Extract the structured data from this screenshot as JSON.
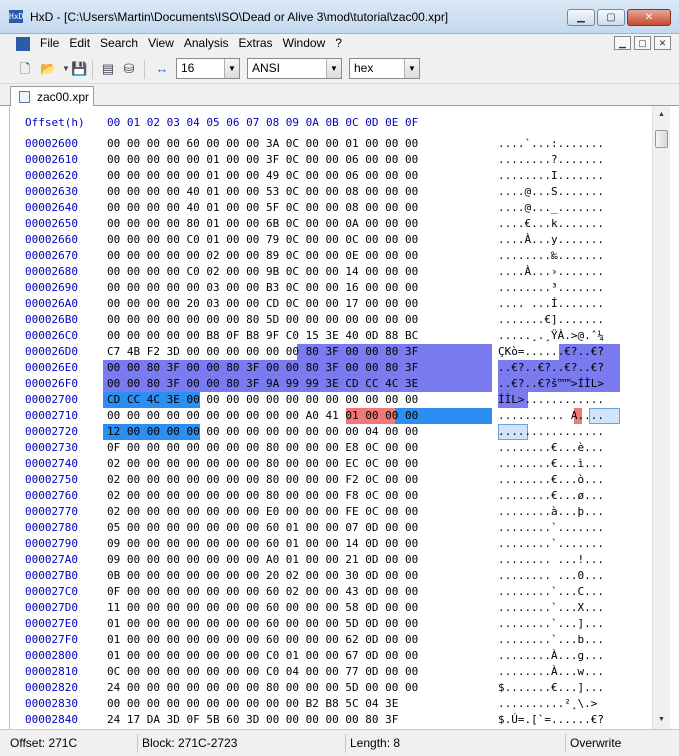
{
  "window": {
    "app_icon": "HxD",
    "title": "HxD - [C:\\Users\\Martin\\Documents\\ISO\\Dead or Alive 3\\mod\\tutorial\\zac00.xpr]",
    "minimize": "▁",
    "maximize": "▢",
    "close": "✕"
  },
  "menu": {
    "items": [
      "File",
      "Edit",
      "Search",
      "View",
      "Analysis",
      "Extras",
      "Window",
      "?"
    ],
    "mdi": [
      "▁",
      "▢",
      "✕"
    ]
  },
  "toolbar": {
    "bytes_per_row": "16",
    "charset": "ANSI",
    "offset_base": "hex",
    "icons": [
      "new-file-icon",
      "open-file-icon",
      "dropdown-arrow-icon",
      "save-icon",
      "ram-icon",
      "disk-icon",
      "columns-icon"
    ]
  },
  "tab": {
    "label": "zac00.xpr"
  },
  "editor": {
    "header_offset": "Offset(h)",
    "header_bytes": "00 01 02 03 04 05 06 07 08 09 0A 0B 0C 0D 0E 0F",
    "rows": [
      {
        "off": "00002600",
        "hex": "00 00 00 00 60 00 00 00 3A 0C 00 00 01 00 00 00",
        "txt": "....`...:......."
      },
      {
        "off": "00002610",
        "hex": "00 00 00 00 00 01 00 00 3F 0C 00 00 06 00 00 00",
        "txt": "........?......."
      },
      {
        "off": "00002620",
        "hex": "00 00 00 00 00 01 00 00 49 0C 00 00 06 00 00 00",
        "txt": "........I......."
      },
      {
        "off": "00002630",
        "hex": "00 00 00 00 40 01 00 00 53 0C 00 00 08 00 00 00",
        "txt": "....@...S......."
      },
      {
        "off": "00002640",
        "hex": "00 00 00 00 40 01 00 00 5F 0C 00 00 08 00 00 00",
        "txt": "....@..._......."
      },
      {
        "off": "00002650",
        "hex": "00 00 00 00 80 01 00 00 6B 0C 00 00 0A 00 00 00",
        "txt": "....€...k......."
      },
      {
        "off": "00002660",
        "hex": "00 00 00 00 C0 01 00 00 79 0C 00 00 0C 00 00 00",
        "txt": "....À...y......."
      },
      {
        "off": "00002670",
        "hex": "00 00 00 00 00 02 00 00 89 0C 00 00 0E 00 00 00",
        "txt": "........‰......."
      },
      {
        "off": "00002680",
        "hex": "00 00 00 00 C0 02 00 00 9B 0C 00 00 14 00 00 00",
        "txt": "....À...›......."
      },
      {
        "off": "00002690",
        "hex": "00 00 00 00 00 03 00 00 B3 0C 00 00 16 00 00 00",
        "txt": "........³......."
      },
      {
        "off": "000026A0",
        "hex": "00 00 00 00 20 03 00 00 CD 0C 00 00 17 00 00 00",
        "txt": ".... ...Í......."
      },
      {
        "off": "000026B0",
        "hex": "00 00 00 00 00 00 00 80 5D 00 00 00 00 00 00 00",
        "txt": ".......€]......."
      },
      {
        "off": "000026C0",
        "hex": "00 00 00 00 00 B8 0F B8 9F C0 15 3E 40 0D 88 BC",
        "txt": ".....¸.¸ŸÀ.>@.ˆ¼"
      },
      {
        "off": "000026D0",
        "hex": "C7 4B F2 3D 00 00 00 00 00 00 80 3F 00 00 80 3F",
        "txt": "ÇKò=......€?..€?"
      },
      {
        "off": "000026E0",
        "hex": "00 00 80 3F 00 00 80 3F 00 00 80 3F 00 00 80 3F",
        "txt": "..€?..€?..€?..€?"
      },
      {
        "off": "000026F0",
        "hex": "00 00 80 3F 00 00 80 3F 9A 99 99 3E CD CC 4C 3E",
        "txt": "..€?..€?š™™>ÍÌL>"
      },
      {
        "off": "00002700",
        "hex": "CD CC 4C 3E 00 00 00 00 00 00 00 00 00 00 00 00",
        "txt": "ÍÌL>............"
      },
      {
        "off": "00002710",
        "hex": "00 00 00 00 00 00 00 00 00 00 A0 41 01 00 00 00",
        "txt": ".......... A...."
      },
      {
        "off": "00002720",
        "hex": "12 00 00 00 00 00 00 00 00 00 00 00 00 04 00 00",
        "txt": "................"
      },
      {
        "off": "00002730",
        "hex": "0F 00 00 00 00 00 00 00 80 00 00 00 E8 0C 00 00",
        "txt": "........€...è..."
      },
      {
        "off": "00002740",
        "hex": "02 00 00 00 00 00 00 00 80 00 00 00 EC 0C 00 00",
        "txt": "........€...ì..."
      },
      {
        "off": "00002750",
        "hex": "02 00 00 00 00 00 00 00 80 00 00 00 F2 0C 00 00",
        "txt": "........€...ò..."
      },
      {
        "off": "00002760",
        "hex": "02 00 00 00 00 00 00 00 80 00 00 00 F8 0C 00 00",
        "txt": "........€...ø..."
      },
      {
        "off": "00002770",
        "hex": "02 00 00 00 00 00 00 00 E0 00 00 00 FE 0C 00 00",
        "txt": "........à...þ..."
      },
      {
        "off": "00002780",
        "hex": "05 00 00 00 00 00 00 00 60 01 00 00 07 0D 00 00",
        "txt": "........`......."
      },
      {
        "off": "00002790",
        "hex": "09 00 00 00 00 00 00 00 60 01 00 00 14 0D 00 00",
        "txt": "........`......."
      },
      {
        "off": "000027A0",
        "hex": "09 00 00 00 00 00 00 00 A0 01 00 00 21 0D 00 00",
        "txt": "........ ...!..."
      },
      {
        "off": "000027B0",
        "hex": "0B 00 00 00 00 00 00 00 20 02 00 00 30 0D 00 00",
        "txt": "........ ...0..."
      },
      {
        "off": "000027C0",
        "hex": "0F 00 00 00 00 00 00 00 60 02 00 00 43 0D 00 00",
        "txt": "........`...C..."
      },
      {
        "off": "000027D0",
        "hex": "11 00 00 00 00 00 00 00 60 00 00 00 58 0D 00 00",
        "txt": "........`...X..."
      },
      {
        "off": "000027E0",
        "hex": "01 00 00 00 00 00 00 00 60 00 00 00 5D 0D 00 00",
        "txt": "........`...]..."
      },
      {
        "off": "000027F0",
        "hex": "01 00 00 00 00 00 00 00 60 00 00 00 62 0D 00 00",
        "txt": "........`...b..."
      },
      {
        "off": "00002800",
        "hex": "01 00 00 00 00 00 00 00 C0 01 00 00 67 0D 00 00",
        "txt": "........À...g..."
      },
      {
        "off": "00002810",
        "hex": "0C 00 00 00 00 00 00 00 C0 04 00 00 77 0D 00 00",
        "txt": "........À...w..."
      },
      {
        "off": "00002820",
        "hex": "24 00 00 00 00 00 00 00 80 00 00 00 5D 00 00 00",
        "txt": "$.......€...]..."
      },
      {
        "off": "00002830",
        "hex": "00 00 00 00 00 00 00 00 00 00 B2 B8 5C 04 3E",
        "txt": "..........²¸\\.>"
      },
      {
        "off": "00002840",
        "hex": "24 17 DA 3D 0F 5B 60 3D 00 00 00 00 00 80 3F",
        "txt": "$.Ú=.[`=......€?"
      }
    ]
  },
  "statusbar": {
    "offset": "Offset: 271C",
    "block": "Block: 271C-2723",
    "length": "Length: 8",
    "mode": "Overwrite"
  }
}
